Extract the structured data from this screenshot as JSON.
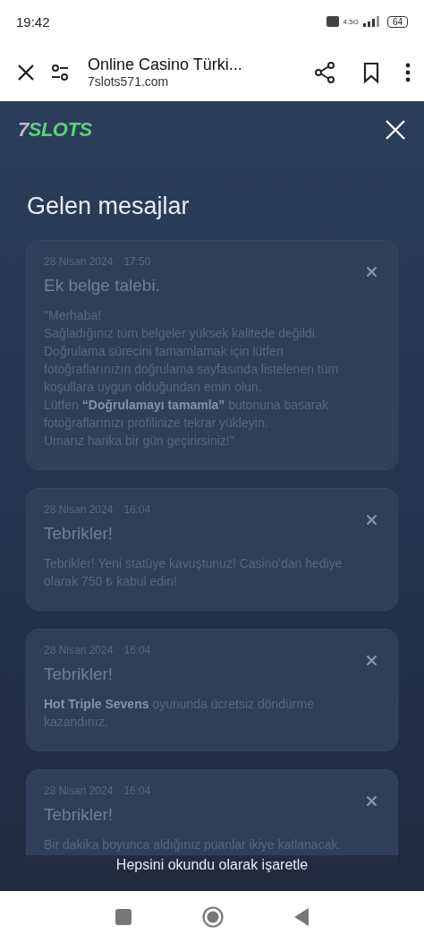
{
  "status_bar": {
    "time": "19:42",
    "network": "4.5G",
    "battery": "64"
  },
  "browser": {
    "title": "Online Casino Türki...",
    "url": "7slots571.com"
  },
  "header": {
    "logo_number": "7",
    "logo_text": "SLOTS"
  },
  "title": "Gelen mesajlar",
  "messages": [
    {
      "date": "28 Nisan 2024",
      "time": "17:50",
      "title": "Ek belge talebi.",
      "body": "\"Merhaba!\nSağladığınız tüm belgeler yüksek kalitede değildi. Doğrulama sürecini tamamlamak için lütfen fotoğraflarınızın doğrulama sayfasında listelenen tüm koşullara uygun olduğundan emin olun.\nLütfen **“Doğrulamayı tamamla”** butonuna basarak fotoğraflarınızı profilinize tekrar yükleyin.\nUmarız harika bir gün geçirirsiniz!\""
    },
    {
      "date": "28 Nisan 2024",
      "time": "16:04",
      "title": "Tebrikler!",
      "body": "Tebrikler! Yeni statüye kavuştunuz! Casino'dan hediye olarak 750 ₺ kabul edin!"
    },
    {
      "date": "28 Nisan 2024",
      "time": "16:04",
      "title": "Tebrikler!",
      "body": "**Hot Triple Sevens** oyununda ücretsiz döndürme kazandınız."
    },
    {
      "date": "28 Nisan 2024",
      "time": "16:04",
      "title": "Tebrikler!",
      "body": "Bir dakika boyunca aldığınız puanlar ikiye katlanacak."
    }
  ],
  "mark_all_button": "Hepsini okundu olarak işaretle"
}
